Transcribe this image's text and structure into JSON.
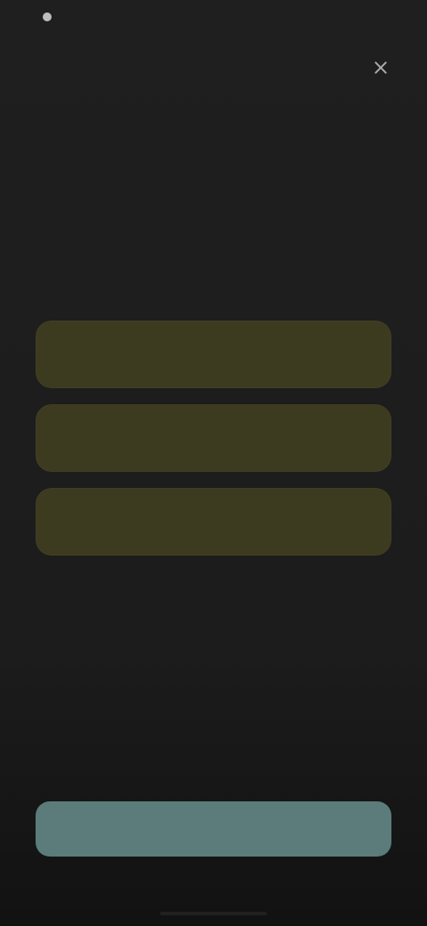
{
  "status_bar": {
    "time": "",
    "icons": [
      "dot"
    ]
  },
  "header": {
    "title": ""
  },
  "content": {
    "title": "",
    "subtitle": ""
  },
  "options": [
    {
      "label": ""
    },
    {
      "label": ""
    },
    {
      "label": ""
    }
  ],
  "links": {
    "secondary": "",
    "tertiary": ""
  },
  "cta": {
    "label": ""
  },
  "colors": {
    "background": "#1c1c1c",
    "option_bg": "#3d3b1f",
    "cta_bg": "#5b7c7b",
    "text_primary": "#f1f1f1",
    "text_secondary": "#bdbdbd"
  }
}
